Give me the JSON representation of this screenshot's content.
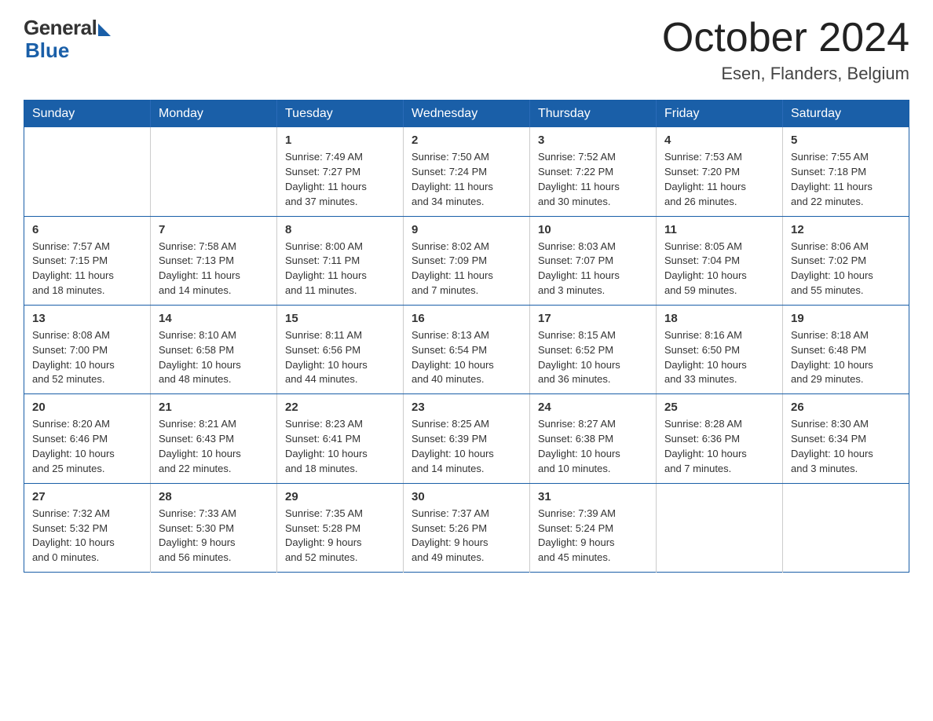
{
  "logo": {
    "general": "General",
    "blue": "Blue"
  },
  "title": "October 2024",
  "location": "Esen, Flanders, Belgium",
  "days_of_week": [
    "Sunday",
    "Monday",
    "Tuesday",
    "Wednesday",
    "Thursday",
    "Friday",
    "Saturday"
  ],
  "weeks": [
    [
      {
        "day": "",
        "info": ""
      },
      {
        "day": "",
        "info": ""
      },
      {
        "day": "1",
        "info": "Sunrise: 7:49 AM\nSunset: 7:27 PM\nDaylight: 11 hours\nand 37 minutes."
      },
      {
        "day": "2",
        "info": "Sunrise: 7:50 AM\nSunset: 7:24 PM\nDaylight: 11 hours\nand 34 minutes."
      },
      {
        "day": "3",
        "info": "Sunrise: 7:52 AM\nSunset: 7:22 PM\nDaylight: 11 hours\nand 30 minutes."
      },
      {
        "day": "4",
        "info": "Sunrise: 7:53 AM\nSunset: 7:20 PM\nDaylight: 11 hours\nand 26 minutes."
      },
      {
        "day": "5",
        "info": "Sunrise: 7:55 AM\nSunset: 7:18 PM\nDaylight: 11 hours\nand 22 minutes."
      }
    ],
    [
      {
        "day": "6",
        "info": "Sunrise: 7:57 AM\nSunset: 7:15 PM\nDaylight: 11 hours\nand 18 minutes."
      },
      {
        "day": "7",
        "info": "Sunrise: 7:58 AM\nSunset: 7:13 PM\nDaylight: 11 hours\nand 14 minutes."
      },
      {
        "day": "8",
        "info": "Sunrise: 8:00 AM\nSunset: 7:11 PM\nDaylight: 11 hours\nand 11 minutes."
      },
      {
        "day": "9",
        "info": "Sunrise: 8:02 AM\nSunset: 7:09 PM\nDaylight: 11 hours\nand 7 minutes."
      },
      {
        "day": "10",
        "info": "Sunrise: 8:03 AM\nSunset: 7:07 PM\nDaylight: 11 hours\nand 3 minutes."
      },
      {
        "day": "11",
        "info": "Sunrise: 8:05 AM\nSunset: 7:04 PM\nDaylight: 10 hours\nand 59 minutes."
      },
      {
        "day": "12",
        "info": "Sunrise: 8:06 AM\nSunset: 7:02 PM\nDaylight: 10 hours\nand 55 minutes."
      }
    ],
    [
      {
        "day": "13",
        "info": "Sunrise: 8:08 AM\nSunset: 7:00 PM\nDaylight: 10 hours\nand 52 minutes."
      },
      {
        "day": "14",
        "info": "Sunrise: 8:10 AM\nSunset: 6:58 PM\nDaylight: 10 hours\nand 48 minutes."
      },
      {
        "day": "15",
        "info": "Sunrise: 8:11 AM\nSunset: 6:56 PM\nDaylight: 10 hours\nand 44 minutes."
      },
      {
        "day": "16",
        "info": "Sunrise: 8:13 AM\nSunset: 6:54 PM\nDaylight: 10 hours\nand 40 minutes."
      },
      {
        "day": "17",
        "info": "Sunrise: 8:15 AM\nSunset: 6:52 PM\nDaylight: 10 hours\nand 36 minutes."
      },
      {
        "day": "18",
        "info": "Sunrise: 8:16 AM\nSunset: 6:50 PM\nDaylight: 10 hours\nand 33 minutes."
      },
      {
        "day": "19",
        "info": "Sunrise: 8:18 AM\nSunset: 6:48 PM\nDaylight: 10 hours\nand 29 minutes."
      }
    ],
    [
      {
        "day": "20",
        "info": "Sunrise: 8:20 AM\nSunset: 6:46 PM\nDaylight: 10 hours\nand 25 minutes."
      },
      {
        "day": "21",
        "info": "Sunrise: 8:21 AM\nSunset: 6:43 PM\nDaylight: 10 hours\nand 22 minutes."
      },
      {
        "day": "22",
        "info": "Sunrise: 8:23 AM\nSunset: 6:41 PM\nDaylight: 10 hours\nand 18 minutes."
      },
      {
        "day": "23",
        "info": "Sunrise: 8:25 AM\nSunset: 6:39 PM\nDaylight: 10 hours\nand 14 minutes."
      },
      {
        "day": "24",
        "info": "Sunrise: 8:27 AM\nSunset: 6:38 PM\nDaylight: 10 hours\nand 10 minutes."
      },
      {
        "day": "25",
        "info": "Sunrise: 8:28 AM\nSunset: 6:36 PM\nDaylight: 10 hours\nand 7 minutes."
      },
      {
        "day": "26",
        "info": "Sunrise: 8:30 AM\nSunset: 6:34 PM\nDaylight: 10 hours\nand 3 minutes."
      }
    ],
    [
      {
        "day": "27",
        "info": "Sunrise: 7:32 AM\nSunset: 5:32 PM\nDaylight: 10 hours\nand 0 minutes."
      },
      {
        "day": "28",
        "info": "Sunrise: 7:33 AM\nSunset: 5:30 PM\nDaylight: 9 hours\nand 56 minutes."
      },
      {
        "day": "29",
        "info": "Sunrise: 7:35 AM\nSunset: 5:28 PM\nDaylight: 9 hours\nand 52 minutes."
      },
      {
        "day": "30",
        "info": "Sunrise: 7:37 AM\nSunset: 5:26 PM\nDaylight: 9 hours\nand 49 minutes."
      },
      {
        "day": "31",
        "info": "Sunrise: 7:39 AM\nSunset: 5:24 PM\nDaylight: 9 hours\nand 45 minutes."
      },
      {
        "day": "",
        "info": ""
      },
      {
        "day": "",
        "info": ""
      }
    ]
  ]
}
